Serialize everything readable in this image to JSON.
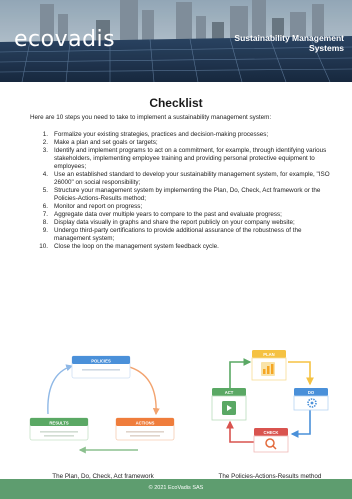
{
  "header": {
    "brand": "ecovadis",
    "title": "Sustainability Management Systems"
  },
  "heading": "Checklist",
  "intro": "Here are 10 steps you need to take to implement a sustainability management system:",
  "steps": [
    {
      "num": "1.",
      "text": "Formalize your existing strategies, practices and decision-making processes;"
    },
    {
      "num": "2.",
      "text": "Make a plan and set goals or targets;"
    },
    {
      "num": "3.",
      "text": "Identify and implement programs to act on a commitment, for example, through identifying various stakeholders, implementing employee training and providing personal protective equipment to employees;"
    },
    {
      "num": "4.",
      "text": "Use an established standard to develop your sustainability management system, for example, \"ISO 26000\" on social responsibility;"
    },
    {
      "num": "5.",
      "text": "Structure your management system by implementing the Plan, Do, Check, Act framework or the Policies-Actions-Results method;"
    },
    {
      "num": "6.",
      "text": "Monitor and report on progress;"
    },
    {
      "num": "7.",
      "text": "Aggregate data over multiple years to compare to the past and evaluate progress;"
    },
    {
      "num": "8.",
      "text": "Display data visually in graphs and share the report publicly on your company website;"
    },
    {
      "num": "9.",
      "text": "Undergo third-party certifications to provide additional assurance of the robustness of the management system;"
    },
    {
      "num": "10.",
      "text": "Close the loop on the management system feedback cycle."
    }
  ],
  "left_diagram": {
    "caption": "The Plan, Do, Check, Act framework",
    "policies": "POLICIES",
    "actions": "ACTIONS",
    "results": "RESULTS"
  },
  "right_diagram": {
    "caption": "The Policies-Actions-Results method",
    "plan": "PLAN",
    "do": "DO",
    "check": "CHECK",
    "act": "ACT"
  },
  "footer": {
    "text": "© 2021 EcoVadis SAS"
  },
  "colors": {
    "footer": "#5e9d6f",
    "blue": "#4a90d9",
    "orange": "#ef7d3c",
    "green": "#5aa864",
    "red": "#d9534f",
    "yellow": "#f5c242"
  }
}
